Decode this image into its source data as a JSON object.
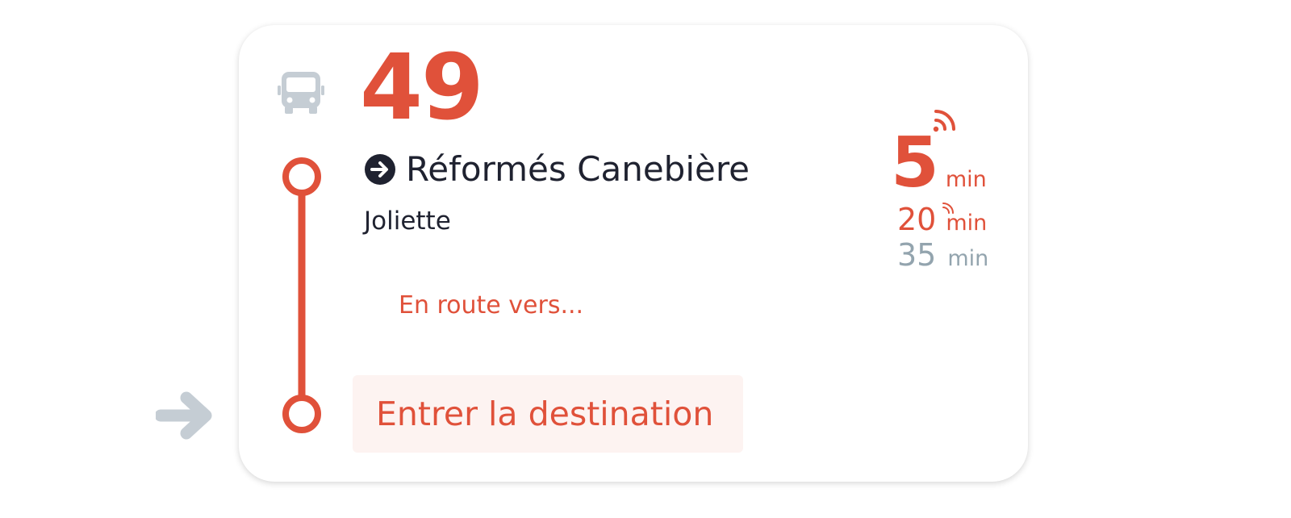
{
  "route": {
    "number": "49",
    "direction": "Réformés Canebière",
    "stop": "Joliette",
    "en_route_label": "En route vers...",
    "destination_button": "Entrer la destination"
  },
  "departures": [
    {
      "value": "5",
      "unit": "min",
      "realtime": true
    },
    {
      "value": "20",
      "unit": "min",
      "realtime": true
    },
    {
      "value": "35",
      "unit": "min",
      "realtime": false
    }
  ],
  "icons": {
    "transport": "bus-icon",
    "direction": "arrow-circle-right-icon",
    "realtime": "realtime-signal-icon",
    "side": "arrow-right-icon"
  },
  "colors": {
    "accent": "#e0513a",
    "text": "#1f2230",
    "muted": "#93a4ae",
    "icon_gray": "#c5cdd4",
    "button_bg": "#fdf3f1"
  }
}
